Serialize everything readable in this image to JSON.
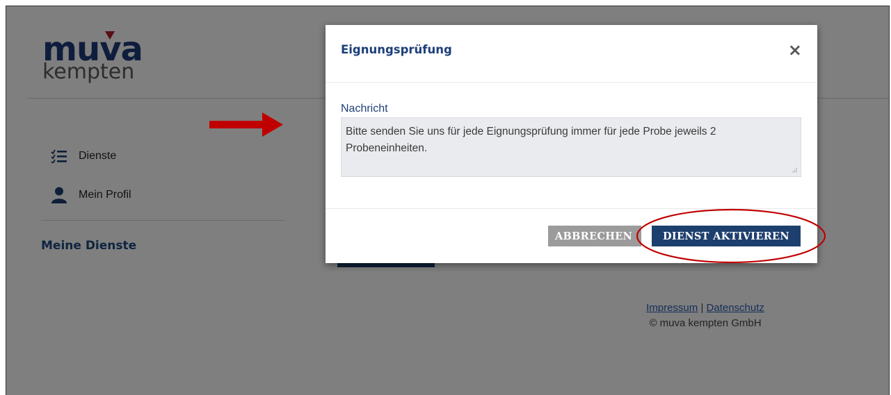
{
  "logo": {
    "line1_a": "mu",
    "line1_v": "v",
    "line1_b": "a",
    "line2": "kempten"
  },
  "nav": {
    "items": [
      {
        "label": "Dienste",
        "icon": "checklist-icon"
      },
      {
        "label": "Mein Profil",
        "icon": "user-icon"
      }
    ],
    "section_title": "Meine Dienste"
  },
  "footer": {
    "impressum": "Impressum",
    "separator": " | ",
    "datenschutz": "Datenschutz",
    "copyright": "© muva kempten GmbH"
  },
  "modal": {
    "title": "Eignungsprüfung",
    "close_symbol": "×",
    "field_label": "Nachricht",
    "message": "Bitte senden Sie uns für jede Eignungsprüfung immer für jede Probe jeweils 2 Probeneinheiten.",
    "cancel_label": "ABBRECHEN",
    "activate_label": "DIENST AKTIVIEREN"
  },
  "colors": {
    "brand_blue": "#1d3f6e",
    "annotation_red": "#c00000",
    "cancel_gray": "#9b9b9b"
  }
}
